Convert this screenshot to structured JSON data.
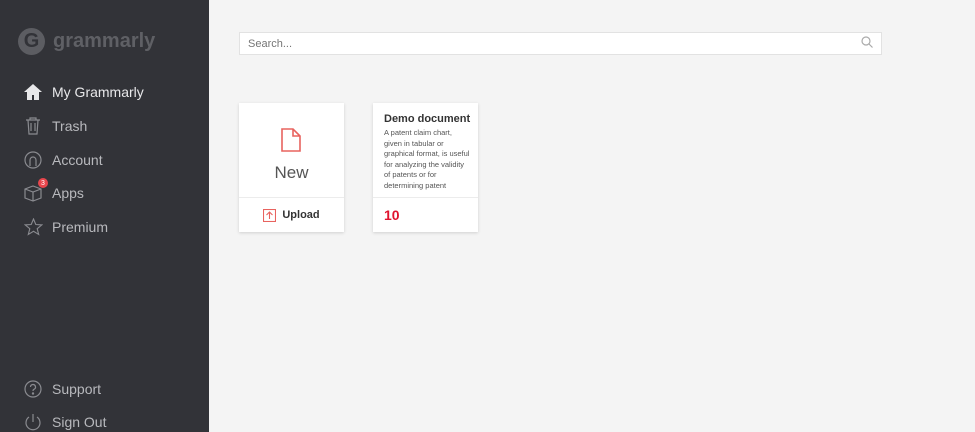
{
  "app": {
    "logo_text": "grammarly"
  },
  "sidebar": {
    "items": [
      {
        "label": "My Grammarly",
        "icon": "home-icon"
      },
      {
        "label": "Trash",
        "icon": "trash-icon"
      },
      {
        "label": "Account",
        "icon": "account-icon"
      },
      {
        "label": "Apps",
        "icon": "box-icon",
        "badge": "3"
      },
      {
        "label": "Premium",
        "icon": "star-icon"
      }
    ],
    "bottom": [
      {
        "label": "Support",
        "icon": "help-icon"
      },
      {
        "label": "Sign Out",
        "icon": "power-icon"
      }
    ]
  },
  "search": {
    "placeholder": "Search...",
    "value": ""
  },
  "new_card": {
    "label": "New",
    "upload_label": "Upload"
  },
  "documents": [
    {
      "title": "Demo document",
      "preview": "A patent claim chart, given in tabular or graphical format, is useful for analyzing the validity of patents or for determining patent",
      "count": "10"
    }
  ],
  "colors": {
    "accent": "#e0132e",
    "sidebar": "#323338"
  }
}
